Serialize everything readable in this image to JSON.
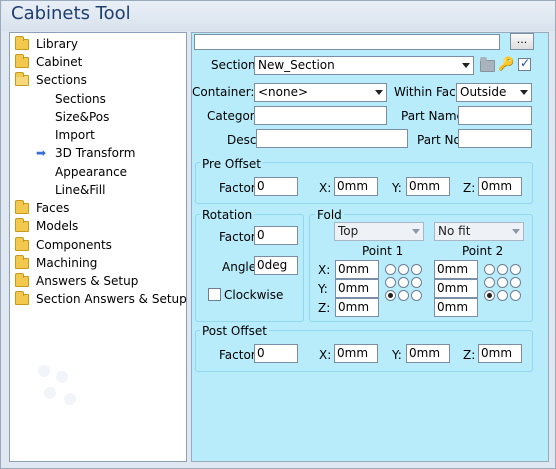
{
  "window": {
    "title": "Cabinets Tool"
  },
  "tree": {
    "items": [
      {
        "label": "Library",
        "icon": "folder-icon"
      },
      {
        "label": "Cabinet",
        "icon": "folder-icon"
      },
      {
        "label": "Sections",
        "icon": "folder-open-icon"
      },
      {
        "label": "Sections"
      },
      {
        "label": "Size&Pos"
      },
      {
        "label": "Import"
      },
      {
        "label": "3D Transform",
        "selected": true,
        "icon": "arrow-right-icon"
      },
      {
        "label": "Appearance"
      },
      {
        "label": "Line&Fill"
      },
      {
        "label": "Faces",
        "icon": "folder-icon"
      },
      {
        "label": "Models",
        "icon": "folder-icon"
      },
      {
        "label": "Components",
        "icon": "folder-icon"
      },
      {
        "label": "Machining",
        "icon": "folder-icon"
      },
      {
        "label": "Answers & Setup",
        "icon": "folder-icon"
      },
      {
        "label": "Section Answers & Setup",
        "icon": "folder-icon"
      }
    ]
  },
  "toolbar": {
    "path_value": "",
    "browse_label": "..."
  },
  "form": {
    "section_label": "Section:",
    "section_value": "New_Section",
    "lock_checked": true,
    "container_label": "Container:",
    "container_value": "<none>",
    "within_face_label": "Within Face:",
    "within_face_value": "Outside",
    "category_label": "Category:",
    "category_value": "",
    "part_name_label": "Part Name:",
    "part_name_value": "",
    "desc_label": "Desc:",
    "desc_value": "",
    "part_no_label": "Part No:",
    "part_no_value": ""
  },
  "pre_offset": {
    "title": "Pre Offset",
    "factor_label": "Factor:",
    "factor_value": "0",
    "x_label": "X:",
    "x_value": "0mm",
    "y_label": "Y:",
    "y_value": "0mm",
    "z_label": "Z:",
    "z_value": "0mm"
  },
  "rotation": {
    "title": "Rotation",
    "factor_label": "Factor:",
    "factor_value": "0",
    "angle_label": "Angle:",
    "angle_value": "0deg",
    "clockwise_label": "Clockwise",
    "clockwise_checked": false
  },
  "fold": {
    "title": "Fold",
    "mode_value": "Top",
    "fit_value": "No fit",
    "point1_label": "Point 1",
    "point2_label": "Point 2",
    "x_label": "X:",
    "y_label": "Y:",
    "z_label": "Z:",
    "p1": {
      "x": "0mm",
      "y": "0mm",
      "z": "0mm"
    },
    "p2": {
      "x": "0mm",
      "y": "0mm",
      "z": "0mm"
    }
  },
  "post_offset": {
    "title": "Post Offset",
    "factor_label": "Factor:",
    "factor_value": "0",
    "x_label": "X:",
    "x_value": "0mm",
    "y_label": "Y:",
    "y_value": "0mm",
    "z_label": "Z:",
    "z_value": "0mm"
  }
}
